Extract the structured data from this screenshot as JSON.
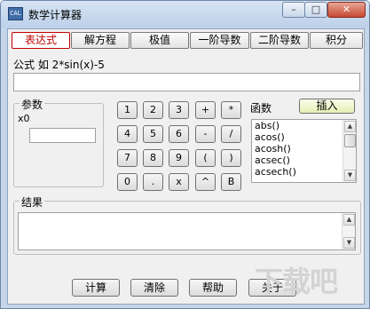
{
  "window": {
    "title": "数学计算器",
    "icon": "calculator-app-icon",
    "controls": {
      "minimize": "–",
      "maximize": "□",
      "close": "✕"
    }
  },
  "tabs": [
    {
      "label": "表达式",
      "active": true
    },
    {
      "label": "解方程",
      "active": false
    },
    {
      "label": "极值",
      "active": false
    },
    {
      "label": "一阶导数",
      "active": false
    },
    {
      "label": "二阶导数",
      "active": false
    },
    {
      "label": "积分",
      "active": false
    }
  ],
  "expression": {
    "label": "公式 如 2*sin(x)-5",
    "value": ""
  },
  "params": {
    "title": "参数",
    "x_label": "x0",
    "x_value": ""
  },
  "keypad": [
    [
      "1",
      "2",
      "3",
      "+",
      "*"
    ],
    [
      "4",
      "5",
      "6",
      "-",
      "/"
    ],
    [
      "7",
      "8",
      "9",
      "(",
      ")"
    ],
    [
      "0",
      ".",
      "x",
      "^",
      "B"
    ]
  ],
  "functions": {
    "label": "函数",
    "insert_label": "插入",
    "items": [
      "abs()",
      "acos()",
      "acosh()",
      "acsec()",
      "acsech()"
    ]
  },
  "result": {
    "title": "结果",
    "value": ""
  },
  "buttons": {
    "calculate": "计算",
    "clear": "清除",
    "help": "帮助",
    "about": "关于"
  },
  "watermark": "下载吧"
}
